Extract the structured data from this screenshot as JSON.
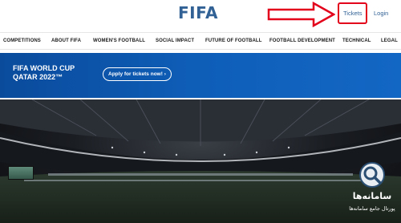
{
  "header": {
    "logo": "FIFA",
    "tickets_label": "Tickets",
    "login_label": "Login"
  },
  "nav": {
    "items": [
      "COMPETITIONS",
      "ABOUT FIFA",
      "WOMEN'S FOOTBALL",
      "SOCIAL IMPACT",
      "FUTURE OF FOOTBALL",
      "FOOTBALL DEVELOPMENT",
      "TECHNICAL",
      "LEGAL"
    ]
  },
  "banner": {
    "title": "FIFA WORLD CUP QATAR 2022™",
    "apply_label": "Apply for tickets now! ›"
  },
  "watermark": {
    "line1": "سامانه‌ها",
    "line2": "پورتال جامع سامانه‌ها"
  },
  "colors": {
    "brand_blue": "#326295",
    "banner_blue": "#0e5eb8",
    "highlight_red": "#e3001b"
  }
}
